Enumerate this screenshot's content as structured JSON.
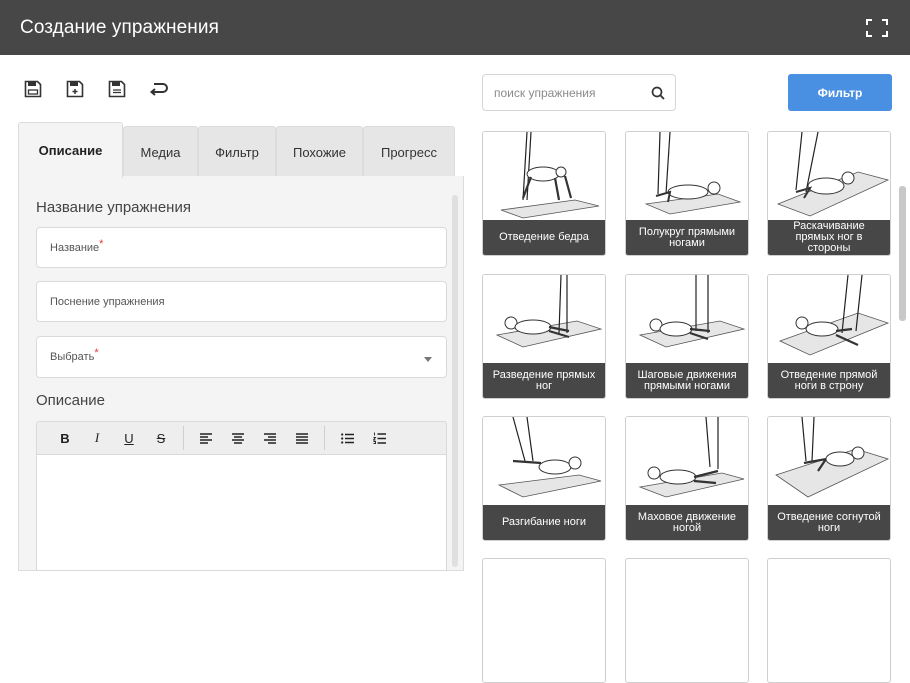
{
  "window": {
    "title": "Создание упражнения",
    "fullscreen_icon": "fullscreen-icon"
  },
  "toolbar": {
    "buttons": [
      {
        "icon": "save-icon"
      },
      {
        "icon": "save-add-icon"
      },
      {
        "icon": "save-as-icon"
      },
      {
        "icon": "undo-icon"
      }
    ]
  },
  "search": {
    "placeholder": "поиск упражнения",
    "icon": "search-icon"
  },
  "filter_button": {
    "label": "Фильтр",
    "color": "#4a90e2"
  },
  "tabs": [
    {
      "label": "Описание",
      "active": true
    },
    {
      "label": "Медиа"
    },
    {
      "label": "Фильтр"
    },
    {
      "label": "Похожие"
    },
    {
      "label": "Прогресс"
    }
  ],
  "form": {
    "name_section": "Название упражнения",
    "name_field": {
      "placeholder": "Название",
      "required": "*"
    },
    "explanation_field": {
      "placeholder": "Поснение упражнения"
    },
    "select_field": {
      "placeholder": "Выбрать",
      "required": "*"
    },
    "description_section": "Описание",
    "editor_buttons": {
      "bold": "B",
      "italic": "I",
      "underline": "U",
      "strike": "S"
    }
  },
  "exercises": [
    {
      "caption": "Отведение бедра"
    },
    {
      "caption": "Полукруг прямыми ногами"
    },
    {
      "caption": "Раскачивание прямых ног в стороны"
    },
    {
      "caption": "Разведение прямых ног"
    },
    {
      "caption": "Шаговые движения прямыми ногами"
    },
    {
      "caption": "Отведение прямой ноги в строну"
    },
    {
      "caption": "Разгибание ноги"
    },
    {
      "caption": "Маховое движение ногой"
    },
    {
      "caption": "Отведение согнутой ноги"
    }
  ],
  "colors": {
    "titlebar": "#474747",
    "caption_bar": "#474747",
    "accent": "#4a90e2",
    "required": "#e53935"
  }
}
